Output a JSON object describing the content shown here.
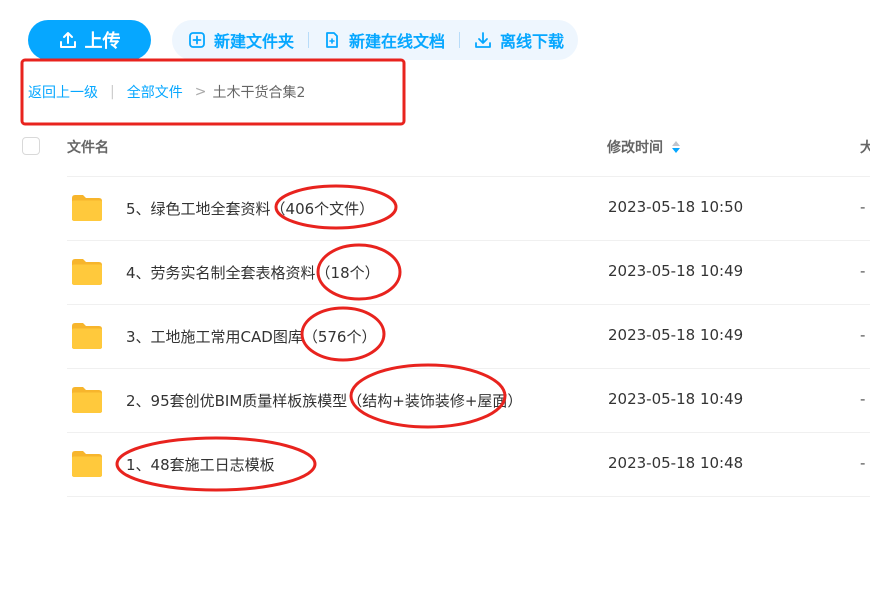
{
  "toolbar": {
    "upload_label": "上传",
    "actions": [
      {
        "label": "新建文件夹",
        "icon": "new-folder-icon"
      },
      {
        "label": "新建在线文档",
        "icon": "new-doc-icon"
      },
      {
        "label": "离线下载",
        "icon": "download-icon"
      }
    ]
  },
  "breadcrumb": {
    "back": "返回上一级",
    "separator": "|",
    "root": "全部文件",
    "arrow": ">",
    "current": "土木干货合集2"
  },
  "table": {
    "columns": {
      "name": "文件名",
      "time": "修改时间",
      "size": "大"
    },
    "rows": [
      {
        "name": "5、绿色工地全套资料（406个文件）",
        "time": "2023-05-18 10:50",
        "size": "-"
      },
      {
        "name": "4、劳务实名制全套表格资料（18个）",
        "time": "2023-05-18 10:49",
        "size": "-"
      },
      {
        "name": "3、工地施工常用CAD图库（576个）",
        "time": "2023-05-18 10:49",
        "size": "-"
      },
      {
        "name": "2、95套创优BIM质量样板族模型（结构+装饰装修+屋面）",
        "time": "2023-05-18 10:49",
        "size": "-"
      },
      {
        "name": "1、48套施工日志模板",
        "time": "2023-05-18 10:48",
        "size": "-"
      }
    ]
  },
  "colors": {
    "accent": "#06a7ff",
    "annotation": "#e8231e",
    "folder": "#ffc93c"
  }
}
